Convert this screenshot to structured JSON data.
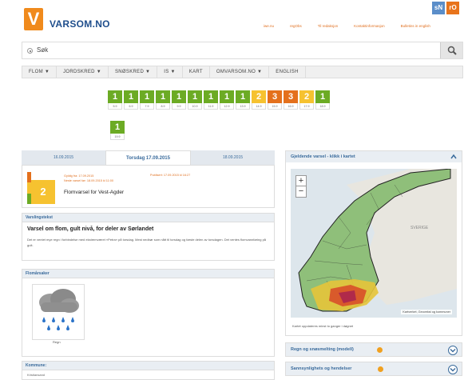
{
  "header": {
    "logo_letter": "V",
    "logo_text": "VARSOM.NO",
    "lang_sn": "sN",
    "lang_ro": "rO",
    "top_links": [
      "iwe.nu",
      "regObs",
      "Til redaksjon",
      "Kontaktinformasjon",
      "Bulletins in english"
    ]
  },
  "search": {
    "label": "Søk"
  },
  "nav": {
    "items": [
      "FLOM ▼",
      "JORDSKRED ▼",
      "SNØSKRED ▼",
      "IS ▼",
      "KART",
      "OMVARSOM.NO ▼",
      "ENGLISH"
    ]
  },
  "tiles": [
    {
      "level": "1",
      "date": "5.9"
    },
    {
      "level": "1",
      "date": "6.9"
    },
    {
      "level": "1",
      "date": "7.9"
    },
    {
      "level": "1",
      "date": "8.9"
    },
    {
      "level": "1",
      "date": "9.9"
    },
    {
      "level": "1",
      "date": "10.9"
    },
    {
      "level": "1",
      "date": "11.9"
    },
    {
      "level": "1",
      "date": "12.9"
    },
    {
      "level": "1",
      "date": "13.9"
    },
    {
      "level": "2",
      "date": "14.9"
    },
    {
      "level": "3",
      "date": "15.9"
    },
    {
      "level": "3",
      "date": "16.9"
    },
    {
      "level": "2",
      "date": "17.9"
    },
    {
      "level": "1",
      "date": "18.9"
    }
  ],
  "tile_single": {
    "level": "1",
    "date": "19.9"
  },
  "level_colors": {
    "1": "#6cab24",
    "2": "#f6c230",
    "3": "#e4701c"
  },
  "day_tabs": {
    "prev": "16.09.2015",
    "active": "Torsdag 17.09.2015",
    "next": "18.09.2015"
  },
  "warning": {
    "level": "2",
    "valid_from": "Gyldig fra: 17.09.2015",
    "next_warning": "Neste varsel før: 18.09.2015 kl 11:00",
    "published": "Publisert: 17.09.2015 kl 16:27",
    "title": "Flomvarsel for Vest-Agder"
  },
  "varsling": {
    "head": "Varslingstekst",
    "title": "Varsel om flom, gult nivå, for deler av Sørlandet",
    "body": "Det er ventet mye regn i forbindelse med ekstremværet «Petra» på torsdag. Mest nedbør som nått til torsdag og første delen av torsdagen. Det ventes flomvannføring på gult."
  },
  "flom": {
    "head": "Flomårsaker",
    "icon_label": "Regn"
  },
  "kommune": {
    "head": "Kommune:",
    "sub": "Kristiansand"
  },
  "map": {
    "head": "Gjeldende varsel - klikk i kartet",
    "zoom_in": "+",
    "zoom_out": "−",
    "attribution": "Kartverket, Geovekst og kommuner",
    "note": "Kartet oppdateres minst to ganger i døgnet",
    "label_sverige": "SVERIGE"
  },
  "accordions": [
    {
      "label": "Regn og snøsmelting (modell)"
    },
    {
      "label": "Sannsynlighets og hendelser"
    }
  ]
}
